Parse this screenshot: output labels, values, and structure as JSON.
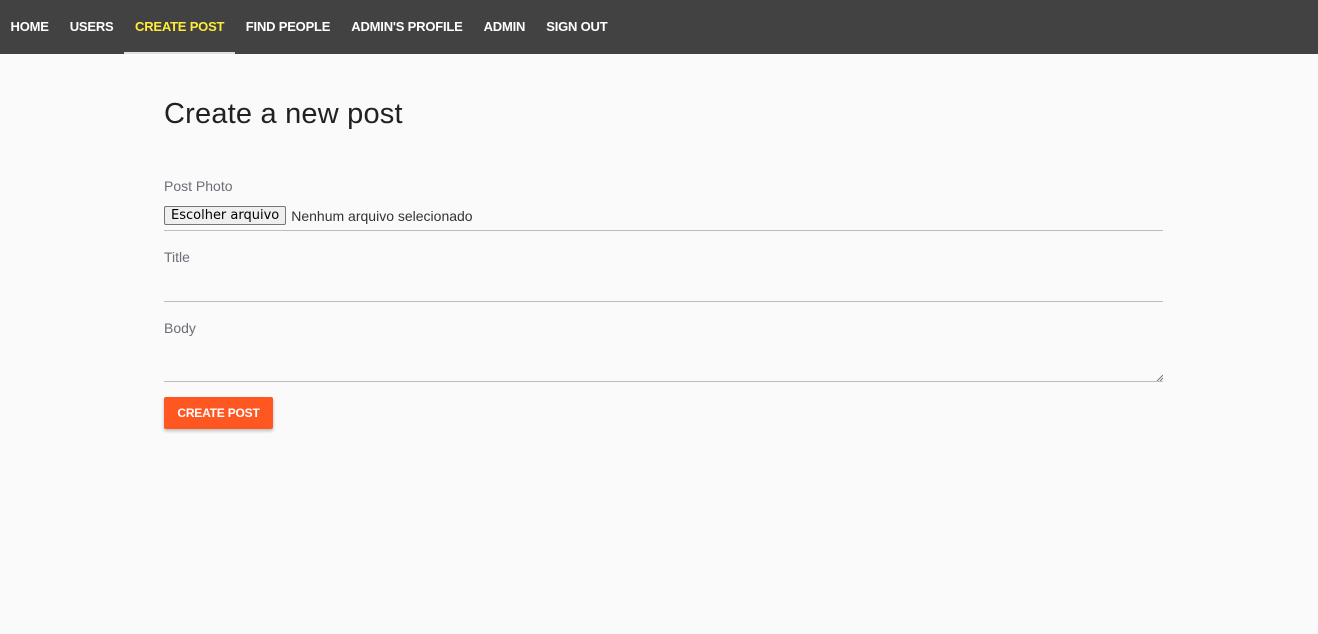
{
  "nav": {
    "items": [
      {
        "label": "HOME"
      },
      {
        "label": "USERS"
      },
      {
        "label": "CREATE POST"
      },
      {
        "label": "FIND PEOPLE"
      },
      {
        "label": "ADMIN'S PROFILE"
      },
      {
        "label": "ADMIN"
      },
      {
        "label": "SIGN OUT"
      }
    ],
    "active_item": "CREATE POST"
  },
  "page": {
    "title": "Create a new post"
  },
  "form": {
    "photo": {
      "label": "Post Photo",
      "button_label": "Escolher arquivo",
      "status": "Nenhum arquivo selecionado"
    },
    "title": {
      "label": "Title",
      "value": ""
    },
    "body": {
      "label": "Body",
      "value": ""
    },
    "submit_label": "CREATE POST"
  },
  "colors": {
    "navbar": "#424242",
    "active_nav_text": "#ffeb3b",
    "accent": "#ff5722",
    "background": "#fafafa"
  }
}
